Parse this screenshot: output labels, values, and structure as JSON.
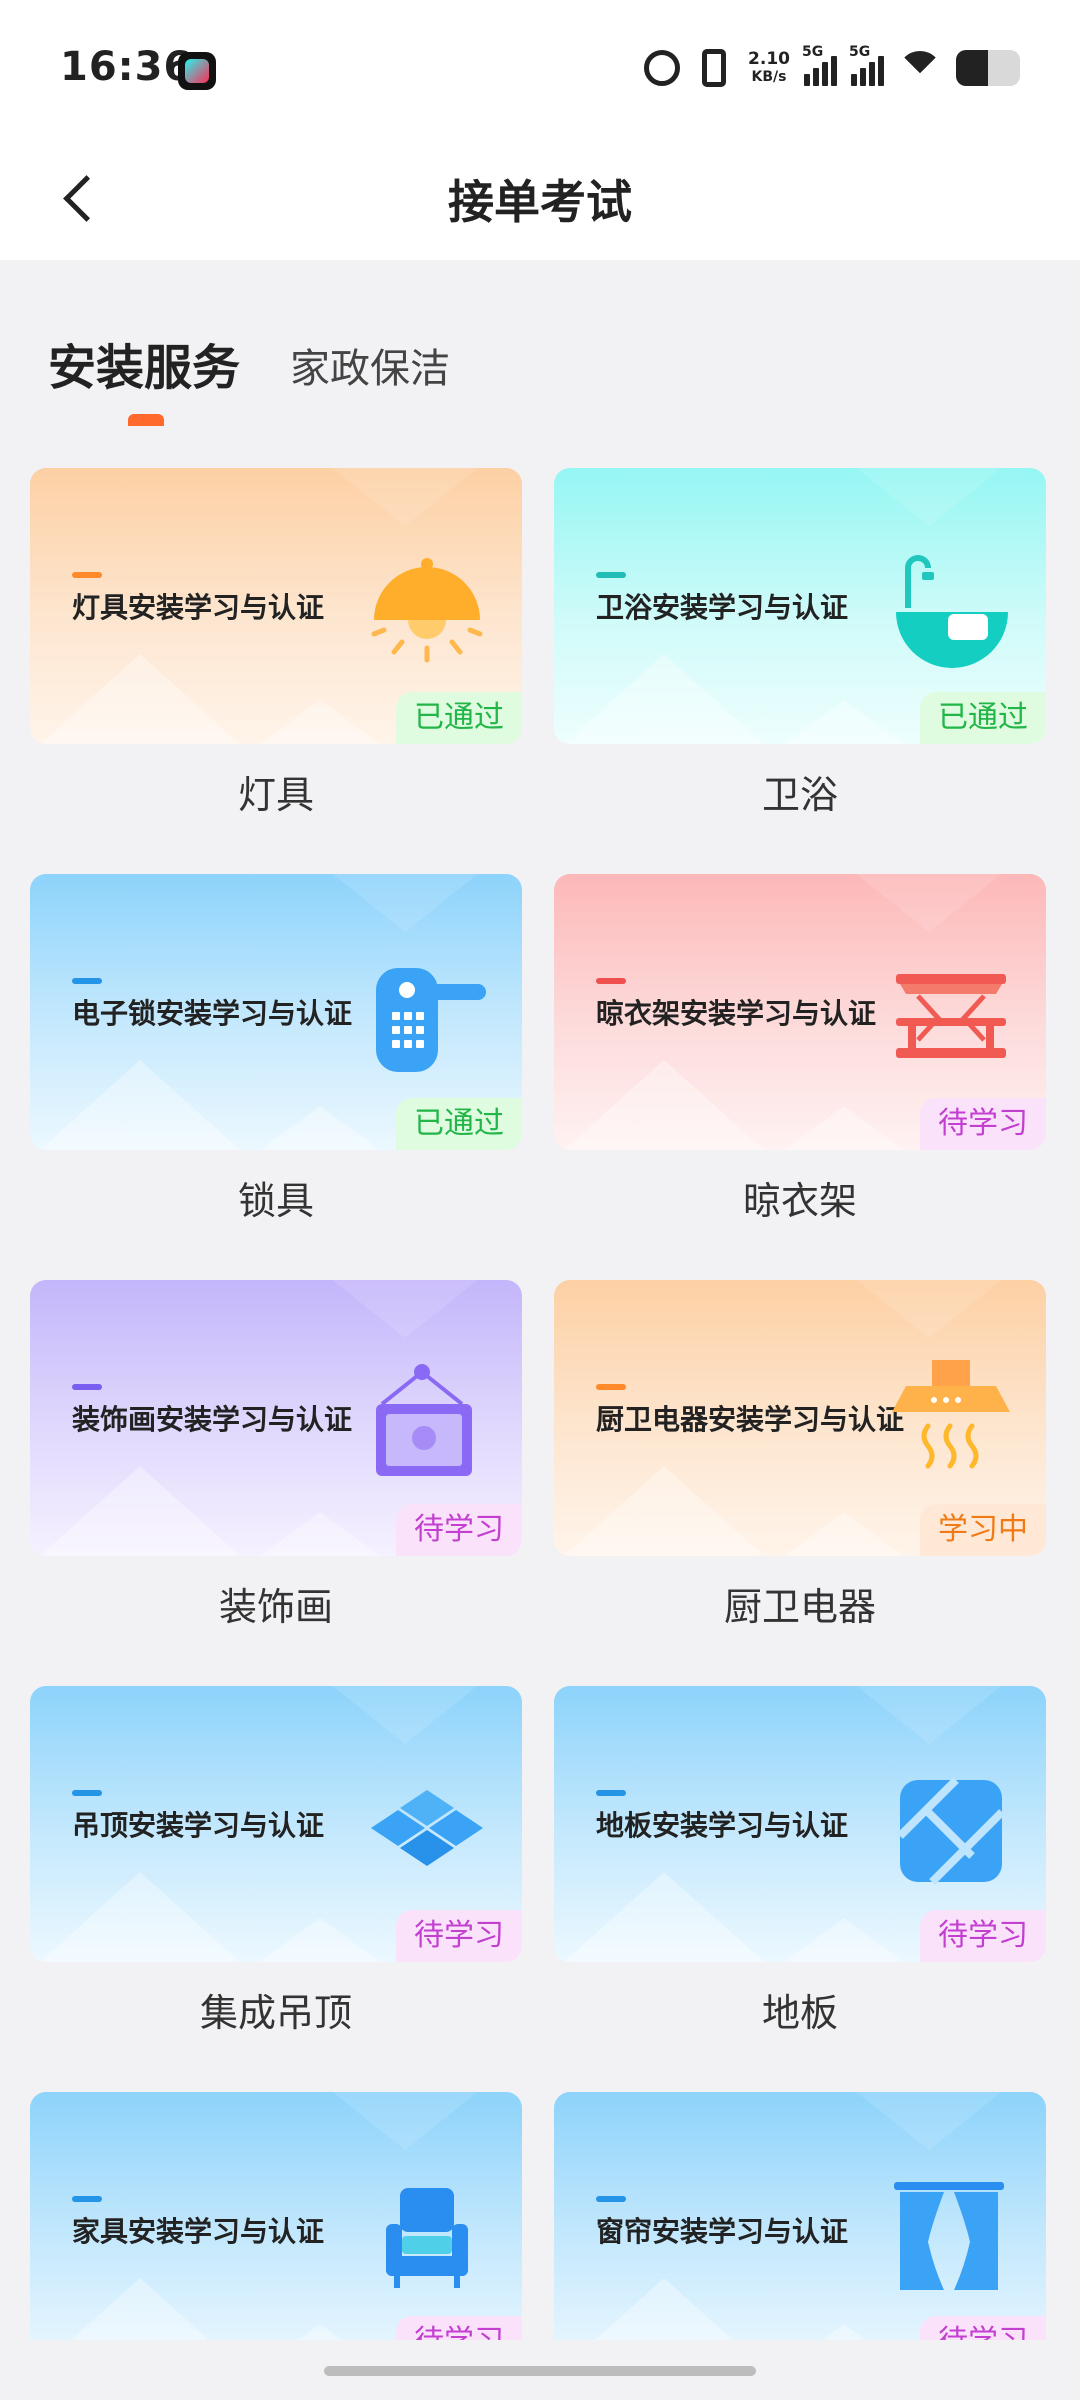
{
  "status_bar": {
    "time": "16:36",
    "net_speed_value": "2.10",
    "net_speed_unit": "KB/s",
    "sim1": "5G",
    "sim2": "5G"
  },
  "nav": {
    "title": "接单考试"
  },
  "tabs": [
    {
      "label": "安装服务",
      "active": true
    },
    {
      "label": "家政保洁",
      "active": false
    }
  ],
  "colors": {
    "accent": "#ff6a2c",
    "passed": "#22b548",
    "pending": "#c23fd0",
    "studying": "#f07a16"
  },
  "cards": [
    {
      "title": "灯具安装学习与认证",
      "status": "已通过",
      "label": "灯具",
      "icon": "lamp-icon"
    },
    {
      "title": "卫浴安装学习与认证",
      "status": "已通过",
      "label": "卫浴",
      "icon": "bathtub-icon"
    },
    {
      "title": "电子锁安装学习与认证",
      "status": "已通过",
      "label": "锁具",
      "icon": "smart-lock-icon"
    },
    {
      "title": "晾衣架安装学习与认证",
      "status": "待学习",
      "label": "晾衣架",
      "icon": "clothes-rack-icon"
    },
    {
      "title": "装饰画安装学习与认证",
      "status": "待学习",
      "label": "装饰画",
      "icon": "picture-frame-icon"
    },
    {
      "title": "厨卫电器安装学习与认证",
      "status": "学习中",
      "label": "厨卫电器",
      "icon": "range-hood-icon"
    },
    {
      "title": "吊顶安装学习与认证",
      "status": "待学习",
      "label": "集成吊顶",
      "icon": "ceiling-tiles-icon"
    },
    {
      "title": "地板安装学习与认证",
      "status": "待学习",
      "label": "地板",
      "icon": "floor-tiles-icon"
    },
    {
      "title": "家具安装学习与认证",
      "status": "待学习",
      "label": "",
      "icon": "armchair-icon"
    },
    {
      "title": "窗帘安装学习与认证",
      "status": "待学习",
      "label": "",
      "icon": "curtain-icon"
    }
  ]
}
